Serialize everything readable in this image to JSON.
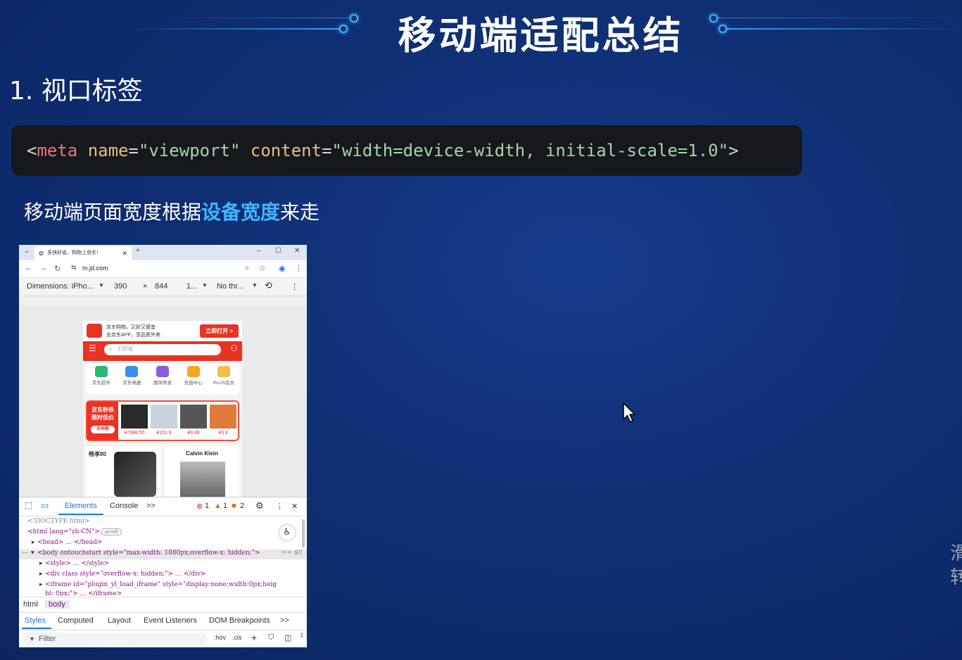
{
  "slide": {
    "title": "移动端适配总结",
    "section_heading": "1. 视口标签",
    "code": {
      "open": "<",
      "tag": "meta",
      "attr1": "name",
      "eq1": "=",
      "val1": "\"viewport\"",
      "attr2": "content",
      "eq2": "=",
      "val2": "\"width=device-width, initial-scale=1.0\"",
      "close": ">"
    },
    "description_before": "移动端页面宽度根据",
    "description_highlight": "设备宽度",
    "description_after": "来走",
    "side_text": "滑转",
    "colors": {
      "highlight": "#3fb6ff",
      "background": "#0f2f74",
      "code_bg": "#16181d"
    }
  },
  "browser": {
    "tab_title": "多快好省，购物上京东！",
    "new_tab": "+",
    "url": "m.jd.com",
    "device_toolbar": {
      "dimensions": "Dimensions: iPho...",
      "width": "390",
      "times": "×",
      "height": "844",
      "zoom": "1...",
      "throttle": "No thr..."
    },
    "page": {
      "promo_line1": "京东购物，又好又便宜",
      "promo_line2": "去京东APP，享品质外卖",
      "open_button": "立即打开 >",
      "search_placeholder": "打印纸",
      "categories": [
        "京东超市",
        "京东电器",
        "服饰美妆",
        "充值中心",
        "PLUS会员"
      ],
      "deal_title": "京东秒杀",
      "deal_sub": "限时低价",
      "deal_btn": "去抢购",
      "prices": [
        "¥7988.55",
        "¥151.9",
        "¥9.88",
        "¥3.9"
      ],
      "left_banner": "畅享80",
      "right_banner": "Calvin Klein"
    },
    "devtools": {
      "tabs": [
        "Elements",
        "Console"
      ],
      "more": ">>",
      "errors": "1",
      "warnings": "1",
      "issues": "2",
      "dom_lines": {
        "doctype": "<!DOCTYPE html>",
        "html_open": "<html lang=\"zh-CN\">",
        "scroll_badge": "scroll",
        "head": "<head> … </head>",
        "body_open": "<body ontouchstart style=\"max-width: 1080px;overflow-x: hidden;\">",
        "body_eq": "== $0",
        "style": "<style> … </style>",
        "div": "<div class style=\"overflow-x: hidden;\"> … </div>",
        "iframe": "<iframe id=\"plugin_yl_load_iframe\" style=\"display:none;width:0px;heig",
        "iframe_cont": "ht: 0px;\"> … </iframe>"
      },
      "breadcrumb": [
        "html",
        "body"
      ],
      "sub_tabs": [
        "Styles",
        "Computed",
        "Layout",
        "Event Listeners",
        "DOM Breakpoints"
      ],
      "sub_more": ">>",
      "filter_placeholder": "Filter",
      "hov": ":hov",
      "cls": ".cls",
      "plus": "+"
    }
  }
}
